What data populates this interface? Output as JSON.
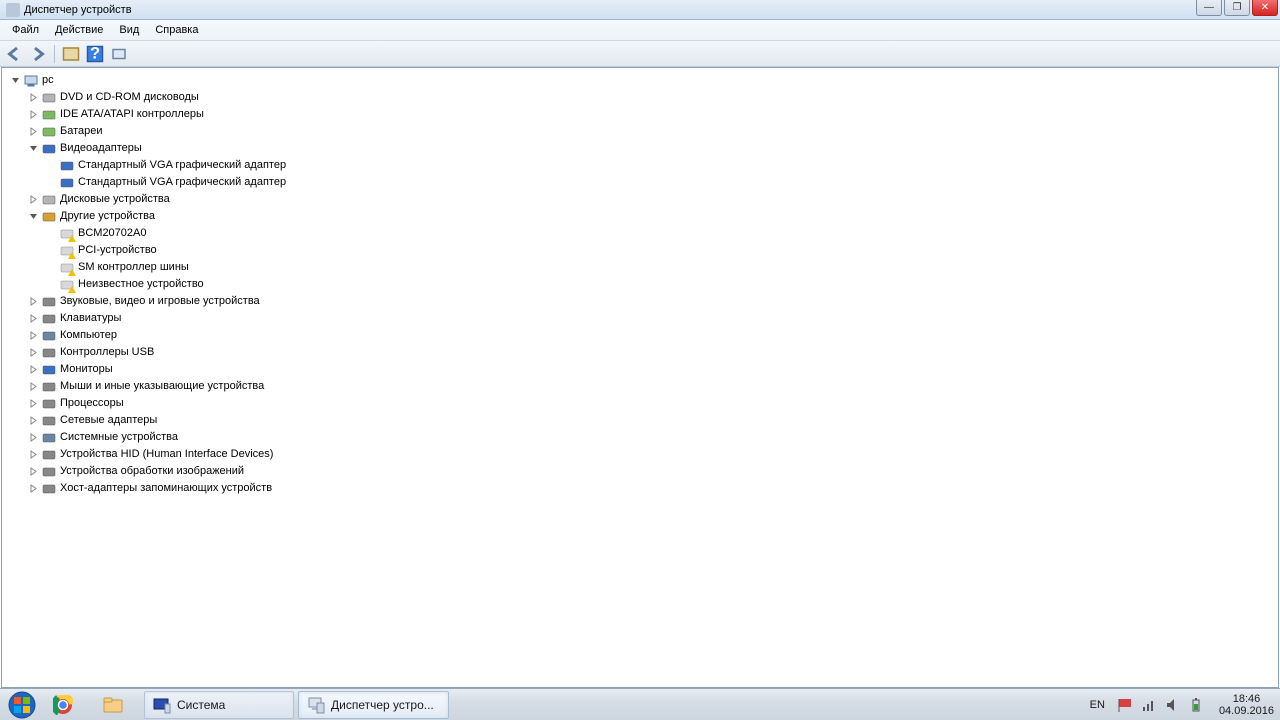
{
  "window": {
    "title": "Диспетчер устройств"
  },
  "menu": {
    "file": "Файл",
    "action": "Действие",
    "view": "Вид",
    "help": "Справка"
  },
  "tree": {
    "root": "pc",
    "dvd": "DVD и CD-ROM дисководы",
    "ide": "IDE ATA/ATAPI контроллеры",
    "batteries": "Батареи",
    "video": "Видеоадаптеры",
    "video_child1": "Стандартный VGA графический адаптер",
    "video_child2": "Стандартный VGA графический адаптер",
    "disks": "Дисковые устройства",
    "other": "Другие устройства",
    "other_bcm": "BCM20702A0",
    "other_pci": "PCI-устройство",
    "other_sm": "SM контроллер шины",
    "other_unknown": "Неизвестное устройство",
    "sound": "Звуковые, видео и игровые устройства",
    "keyboards": "Клавиатуры",
    "computer": "Компьютер",
    "usb": "Контроллеры USB",
    "monitors": "Мониторы",
    "mice": "Мыши и иные указывающие устройства",
    "processors": "Процессоры",
    "network": "Сетевые адаптеры",
    "system": "Системные устройства",
    "hid": "Устройства HID (Human Interface Devices)",
    "imaging": "Устройства обработки изображений",
    "storage": "Хост-адаптеры запоминающих устройств"
  },
  "taskbar": {
    "system_label": "Система",
    "devmgr_label": "Диспетчер устро...",
    "lang": "EN",
    "time": "18:46",
    "date": "04.09.2016"
  }
}
